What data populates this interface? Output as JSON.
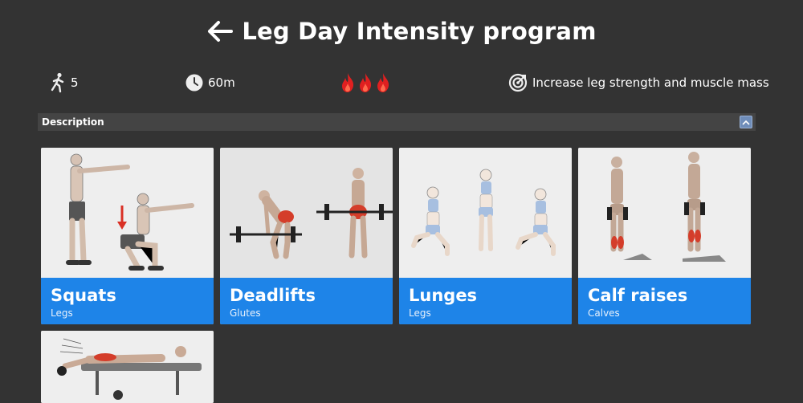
{
  "header": {
    "title": "Leg Day Intensity program",
    "back_icon": "arrow-left-icon"
  },
  "stats": {
    "exercise_count": "5",
    "duration": "60m",
    "intensity_level": 3,
    "goal": "Increase leg strength and muscle mass"
  },
  "description": {
    "label": "Description",
    "expanded": true
  },
  "exercises": [
    {
      "name": "Squats",
      "muscle": "Legs"
    },
    {
      "name": "Deadlifts",
      "muscle": "Glutes"
    },
    {
      "name": "Lunges",
      "muscle": "Legs"
    },
    {
      "name": "Calf raises",
      "muscle": "Calves"
    },
    {
      "name": "",
      "muscle": ""
    }
  ],
  "colors": {
    "background": "#333333",
    "accent": "#1e84e8",
    "flame": "#e02020",
    "desc_bar": "#444444"
  }
}
